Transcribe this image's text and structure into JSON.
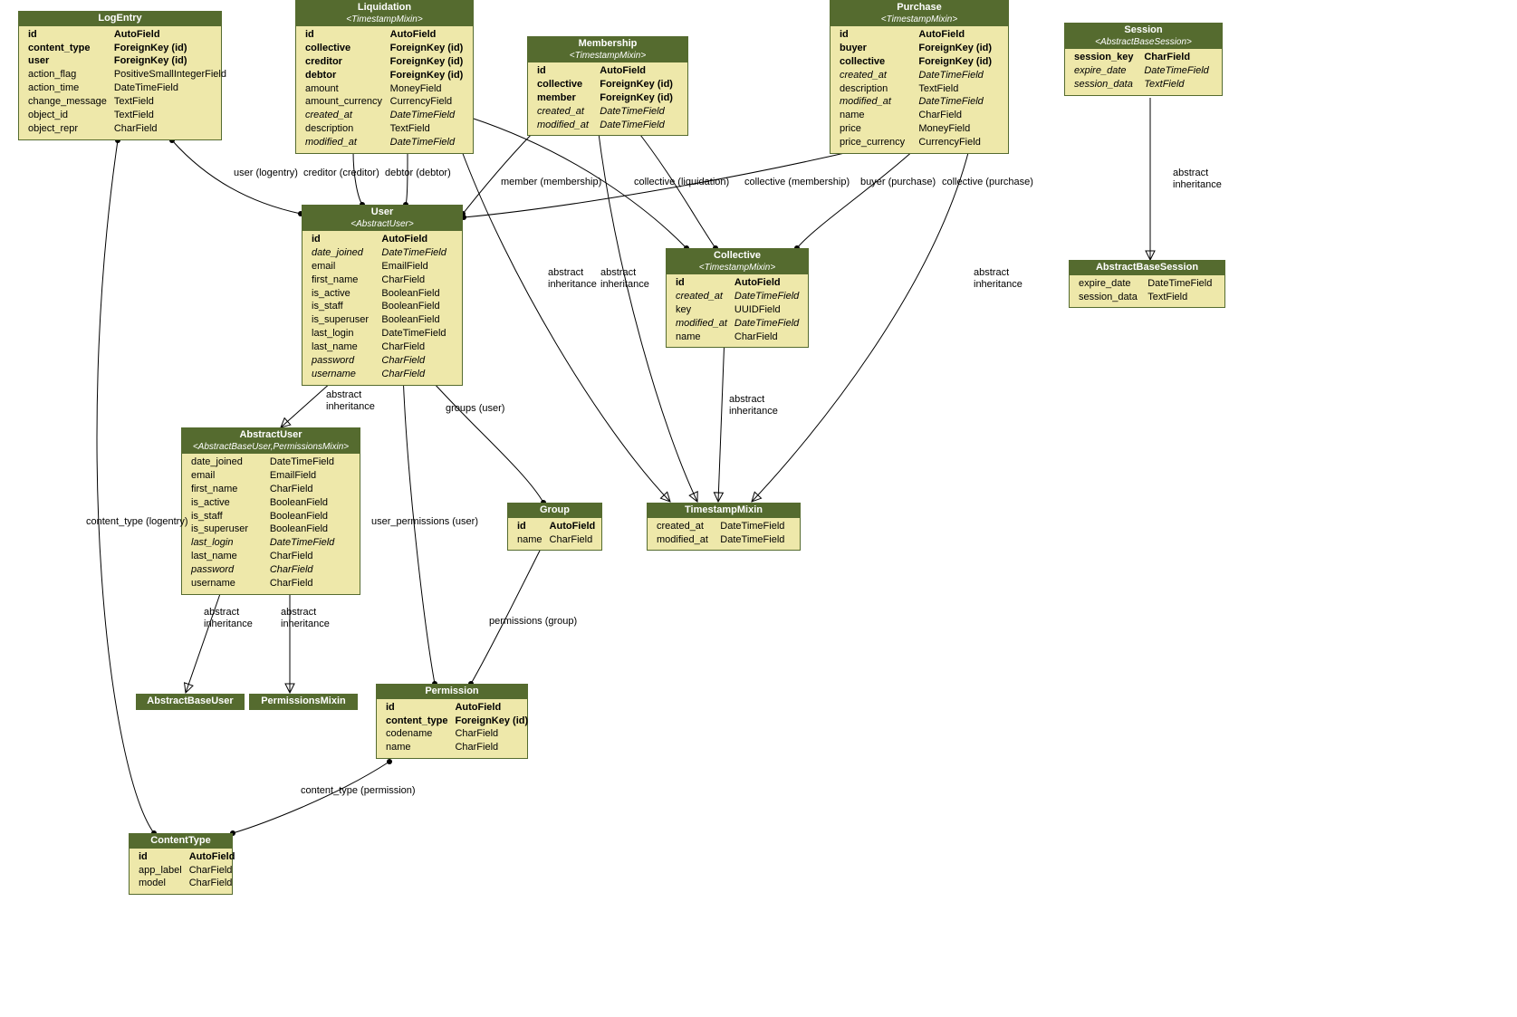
{
  "entities": {
    "LogEntry": {
      "title": "LogEntry",
      "subtitle": null,
      "fields": [
        {
          "name": "id",
          "type": "AutoField",
          "bold": true
        },
        {
          "name": "content_type",
          "type": "ForeignKey (id)",
          "bold": true,
          "grey": true
        },
        {
          "name": "user",
          "type": "ForeignKey (id)",
          "bold": true
        },
        {
          "name": "action_flag",
          "type": "PositiveSmallIntegerField"
        },
        {
          "name": "action_time",
          "type": "DateTimeField"
        },
        {
          "name": "change_message",
          "type": "TextField",
          "grey": true
        },
        {
          "name": "object_id",
          "type": "TextField",
          "grey": true
        },
        {
          "name": "object_repr",
          "type": "CharField"
        }
      ]
    },
    "Liquidation": {
      "title": "Liquidation",
      "subtitle": "<TimestampMixin>",
      "fields": [
        {
          "name": "id",
          "type": "AutoField",
          "bold": true
        },
        {
          "name": "collective",
          "type": "ForeignKey (id)",
          "bold": true
        },
        {
          "name": "creditor",
          "type": "ForeignKey (id)",
          "bold": true
        },
        {
          "name": "debtor",
          "type": "ForeignKey (id)",
          "bold": true
        },
        {
          "name": "amount",
          "type": "MoneyField"
        },
        {
          "name": "amount_currency",
          "type": "CurrencyField"
        },
        {
          "name": "created_at",
          "type": "DateTimeField",
          "italic": true
        },
        {
          "name": "description",
          "type": "TextField",
          "grey": true
        },
        {
          "name": "modified_at",
          "type": "DateTimeField",
          "italic": true,
          "grey": true
        }
      ]
    },
    "Membership": {
      "title": "Membership",
      "subtitle": "<TimestampMixin>",
      "fields": [
        {
          "name": "id",
          "type": "AutoField",
          "bold": true
        },
        {
          "name": "collective",
          "type": "ForeignKey (id)",
          "bold": true
        },
        {
          "name": "member",
          "type": "ForeignKey (id)",
          "bold": true
        },
        {
          "name": "created_at",
          "type": "DateTimeField",
          "italic": true,
          "grey": true
        },
        {
          "name": "modified_at",
          "type": "DateTimeField",
          "italic": true,
          "grey": true
        }
      ]
    },
    "Purchase": {
      "title": "Purchase",
      "subtitle": "<TimestampMixin>",
      "fields": [
        {
          "name": "id",
          "type": "AutoField",
          "bold": true
        },
        {
          "name": "buyer",
          "type": "ForeignKey (id)",
          "bold": true
        },
        {
          "name": "collective",
          "type": "ForeignKey (id)",
          "bold": true
        },
        {
          "name": "created_at",
          "type": "DateTimeField",
          "italic": true,
          "grey": true
        },
        {
          "name": "description",
          "type": "TextField",
          "grey": true
        },
        {
          "name": "modified_at",
          "type": "DateTimeField",
          "italic": true,
          "grey": true
        },
        {
          "name": "name",
          "type": "CharField"
        },
        {
          "name": "price",
          "type": "MoneyField"
        },
        {
          "name": "price_currency",
          "type": "CurrencyField"
        }
      ]
    },
    "Session": {
      "title": "Session",
      "subtitle": "<AbstractBaseSession>",
      "fields": [
        {
          "name": "session_key",
          "type": "CharField",
          "bold": true
        },
        {
          "name": "expire_date",
          "type": "DateTimeField",
          "italic": true
        },
        {
          "name": "session_data",
          "type": "TextField",
          "italic": true
        }
      ]
    },
    "User": {
      "title": "User",
      "subtitle": "<AbstractUser>",
      "fields": [
        {
          "name": "id",
          "type": "AutoField",
          "bold": true
        },
        {
          "name": "date_joined",
          "type": "DateTimeField",
          "italic": true
        },
        {
          "name": "email",
          "type": "EmailField",
          "grey": true
        },
        {
          "name": "first_name",
          "type": "CharField",
          "grey": true
        },
        {
          "name": "is_active",
          "type": "BooleanField",
          "grey": true
        },
        {
          "name": "is_staff",
          "type": "BooleanField",
          "grey": true
        },
        {
          "name": "is_superuser",
          "type": "BooleanField",
          "grey": true
        },
        {
          "name": "last_login",
          "type": "DateTimeField",
          "grey": true
        },
        {
          "name": "last_name",
          "type": "CharField",
          "grey": true
        },
        {
          "name": "password",
          "type": "CharField",
          "italic": true
        },
        {
          "name": "username",
          "type": "CharField",
          "italic": true
        }
      ]
    },
    "Collective": {
      "title": "Collective",
      "subtitle": "<TimestampMixin>",
      "fields": [
        {
          "name": "id",
          "type": "AutoField",
          "bold": true
        },
        {
          "name": "created_at",
          "type": "DateTimeField",
          "italic": true,
          "grey": true
        },
        {
          "name": "key",
          "type": "UUIDField"
        },
        {
          "name": "modified_at",
          "type": "DateTimeField",
          "italic": true,
          "grey": true
        },
        {
          "name": "name",
          "type": "CharField"
        }
      ]
    },
    "AbstractBaseSession": {
      "title": "AbstractBaseSession",
      "subtitle": null,
      "fields": [
        {
          "name": "expire_date",
          "type": "DateTimeField"
        },
        {
          "name": "session_data",
          "type": "TextField"
        }
      ]
    },
    "AbstractUser": {
      "title": "AbstractUser",
      "subtitle": "<AbstractBaseUser,PermissionsMixin>",
      "fields": [
        {
          "name": "date_joined",
          "type": "DateTimeField"
        },
        {
          "name": "email",
          "type": "EmailField",
          "grey": true
        },
        {
          "name": "first_name",
          "type": "CharField",
          "grey": true
        },
        {
          "name": "is_active",
          "type": "BooleanField",
          "grey": true
        },
        {
          "name": "is_staff",
          "type": "BooleanField",
          "grey": true
        },
        {
          "name": "is_superuser",
          "type": "BooleanField",
          "grey": true
        },
        {
          "name": "last_login",
          "type": "DateTimeField",
          "italic": true,
          "grey": true
        },
        {
          "name": "last_name",
          "type": "CharField",
          "grey": true
        },
        {
          "name": "password",
          "type": "CharField",
          "italic": true
        },
        {
          "name": "username",
          "type": "CharField"
        }
      ]
    },
    "TimestampMixin": {
      "title": "TimestampMixin",
      "subtitle": null,
      "fields": [
        {
          "name": "created_at",
          "type": "DateTimeField"
        },
        {
          "name": "modified_at",
          "type": "DateTimeField",
          "grey": true
        }
      ]
    },
    "Group": {
      "title": "Group",
      "subtitle": null,
      "fields": [
        {
          "name": "id",
          "type": "AutoField",
          "bold": true
        },
        {
          "name": "name",
          "type": "CharField"
        }
      ]
    },
    "Permission": {
      "title": "Permission",
      "subtitle": null,
      "fields": [
        {
          "name": "id",
          "type": "AutoField",
          "bold": true
        },
        {
          "name": "content_type",
          "type": "ForeignKey (id)",
          "bold": true
        },
        {
          "name": "codename",
          "type": "CharField"
        },
        {
          "name": "name",
          "type": "CharField"
        }
      ]
    },
    "ContentType": {
      "title": "ContentType",
      "subtitle": null,
      "fields": [
        {
          "name": "id",
          "type": "AutoField",
          "bold": true
        },
        {
          "name": "app_label",
          "type": "CharField"
        },
        {
          "name": "model",
          "type": "CharField"
        }
      ]
    },
    "AbstractBaseUser": {
      "title": "AbstractBaseUser",
      "subtitle": null,
      "fields": []
    },
    "PermissionsMixin": {
      "title": "PermissionsMixin",
      "subtitle": null,
      "fields": []
    }
  },
  "edgeLabels": {
    "userLogentry": "user (logentry)",
    "creditor": "creditor (creditor)",
    "debtor": "debtor (debtor)",
    "memberMembership": "member (membership)",
    "collectiveLiquidation": "collective (liquidation)",
    "collectiveMembership": "collective (membership)",
    "buyerPurchase": "buyer (purchase)",
    "collectivePurchase": "collective (purchase)",
    "abstractInheritance": "abstract\ninheritance",
    "groupsUser": "groups (user)",
    "userPermissionsUser": "user_permissions (user)",
    "permissionsGroup": "permissions (group)",
    "contentTypeLogentry": "content_type (logentry)",
    "contentTypePermission": "content_type (permission)"
  }
}
